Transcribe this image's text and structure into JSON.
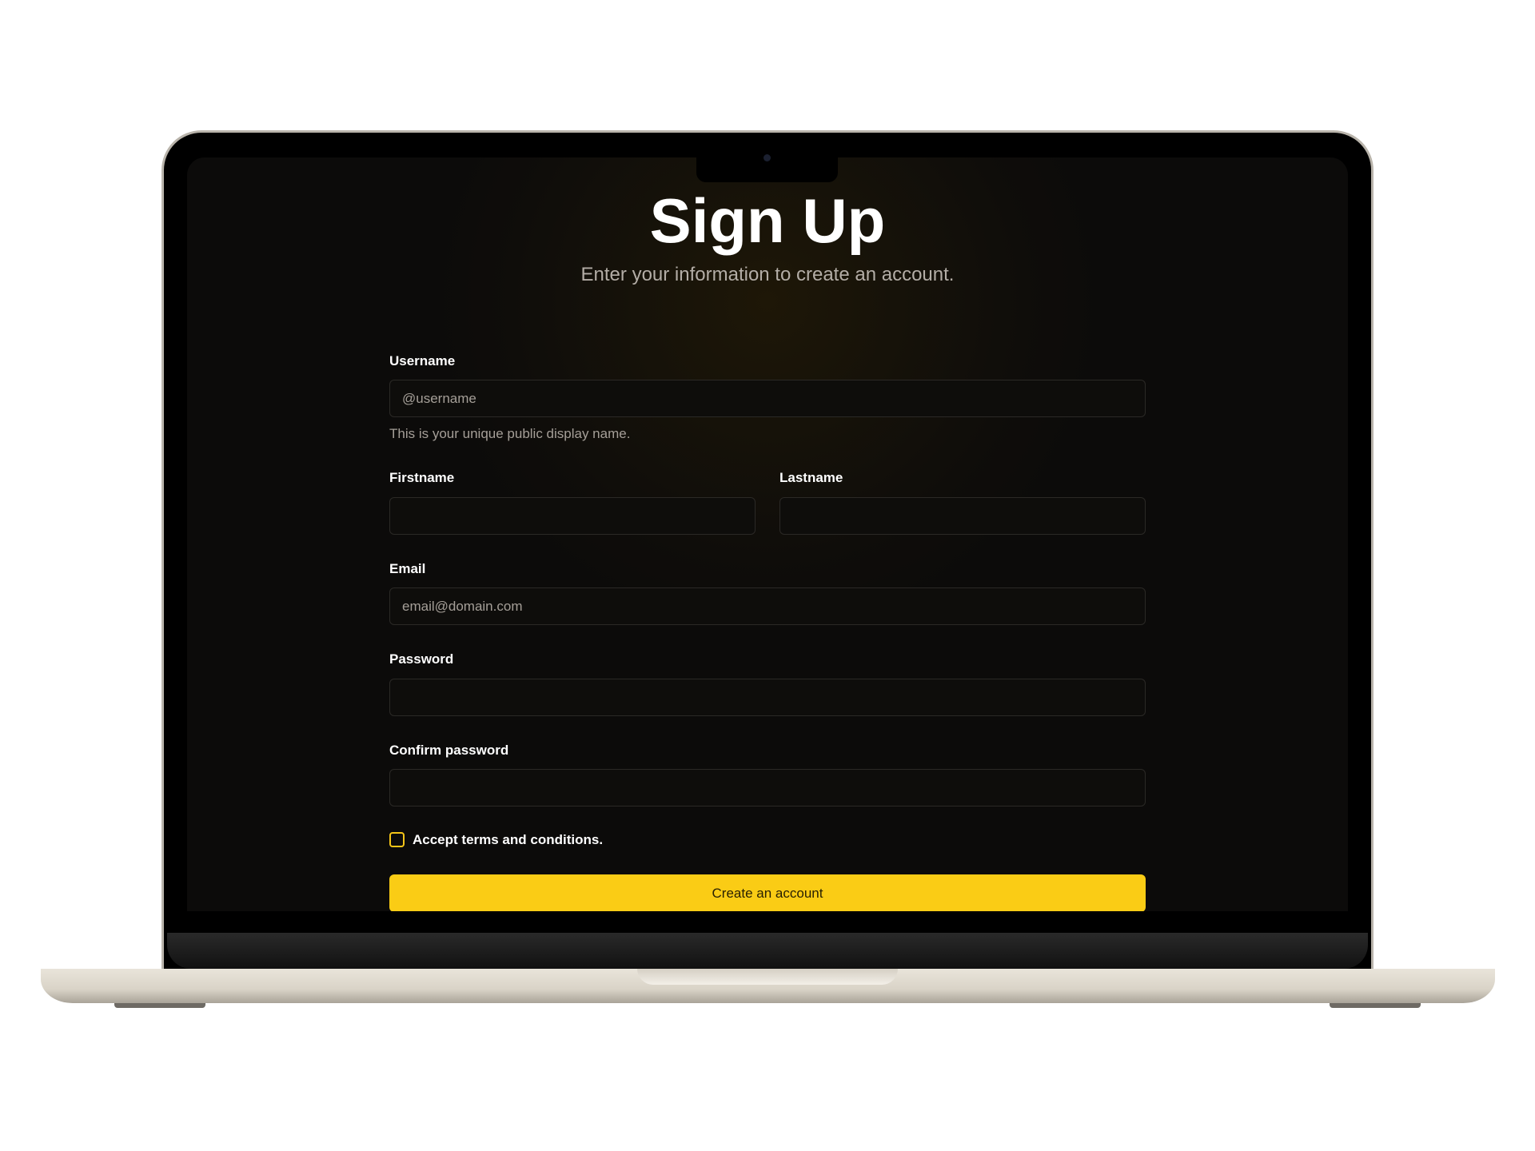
{
  "header": {
    "title": "Sign Up",
    "subtitle": "Enter your information to create an account."
  },
  "form": {
    "username": {
      "label": "Username",
      "placeholder": "@username",
      "help": "This is your unique public display name."
    },
    "firstname": {
      "label": "Firstname"
    },
    "lastname": {
      "label": "Lastname"
    },
    "email": {
      "label": "Email",
      "placeholder": "email@domain.com"
    },
    "password": {
      "label": "Password"
    },
    "confirm_password": {
      "label": "Confirm password"
    },
    "terms": {
      "label": "Accept terms and conditions.",
      "checked": false
    },
    "submit_label": "Create an account"
  },
  "colors": {
    "accent": "#facc15",
    "background": "#0c0b0a"
  }
}
